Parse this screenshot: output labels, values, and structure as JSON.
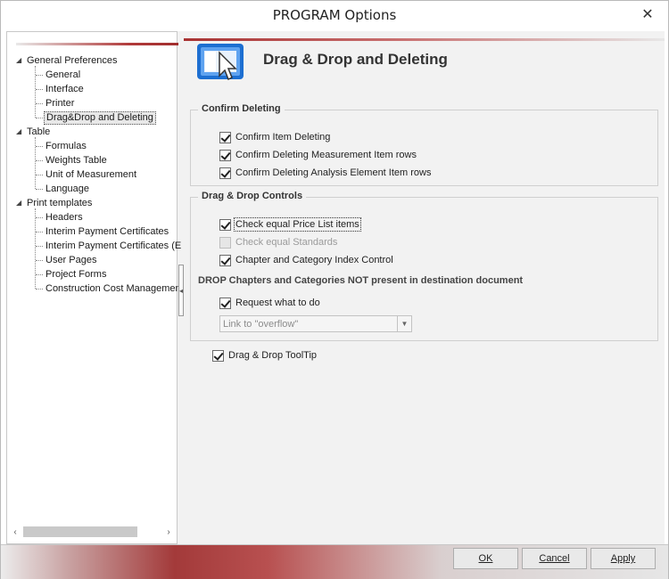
{
  "window": {
    "title": "PROGRAM Options"
  },
  "tree": {
    "items": [
      {
        "label": "General Preferences",
        "level": 0,
        "expanded": true
      },
      {
        "label": "General",
        "level": 1
      },
      {
        "label": "Interface",
        "level": 1
      },
      {
        "label": "Printer",
        "level": 1
      },
      {
        "label": "Drag&Drop and Deleting",
        "level": 1,
        "selected": true
      },
      {
        "label": "Table",
        "level": 0,
        "expanded": true
      },
      {
        "label": "Formulas",
        "level": 1
      },
      {
        "label": "Weights Table",
        "level": 1
      },
      {
        "label": "Unit of Measurement",
        "level": 1
      },
      {
        "label": "Language",
        "level": 1
      },
      {
        "label": "Print templates",
        "level": 0,
        "expanded": true
      },
      {
        "label": "Headers",
        "level": 1
      },
      {
        "label": "Interim Payment Certificates",
        "level": 1
      },
      {
        "label": "Interim Payment Certificates (E",
        "level": 1
      },
      {
        "label": "User Pages",
        "level": 1
      },
      {
        "label": "Project Forms",
        "level": 1
      },
      {
        "label": "Construction Cost Managemen",
        "level": 1
      }
    ]
  },
  "page": {
    "title": "Drag & Drop and Deleting"
  },
  "confirm_deleting": {
    "legend": "Confirm Deleting",
    "options": [
      {
        "label": "Confirm Item Deleting",
        "checked": true
      },
      {
        "label": "Confirm Deleting Measurement Item rows",
        "checked": true
      },
      {
        "label": "Confirm Deleting Analysis Element Item rows",
        "checked": true
      }
    ]
  },
  "drag_drop_controls": {
    "legend": "Drag & Drop Controls",
    "options": [
      {
        "label": "Check equal Price List items",
        "checked": true,
        "focused": true
      },
      {
        "label": "Check equal Standards",
        "checked": false,
        "disabled": true
      },
      {
        "label": "Chapter and Category Index Control",
        "checked": true
      }
    ],
    "drop_heading": "DROP Chapters and Categories NOT present in destination document",
    "request_option": {
      "label": "Request what to do",
      "checked": true
    },
    "link_select": {
      "value": "Link to \"overflow\"",
      "disabled": true
    }
  },
  "tooltip_option": {
    "label": "Drag & Drop ToolTip",
    "checked": true
  },
  "buttons": {
    "ok": "OK",
    "cancel": "Cancel",
    "apply": "Apply"
  },
  "icons": {
    "close": "close-icon",
    "header": "drag-drop-cursor-icon",
    "expand": "triangle-down-icon",
    "scroll_left": "chevron-left-icon",
    "scroll_right": "chevron-right-icon",
    "combo": "chevron-down-icon",
    "splitter": "chevron-left-icon"
  },
  "colors": {
    "accent": "#a83232",
    "selection": "#e8e8e8"
  }
}
